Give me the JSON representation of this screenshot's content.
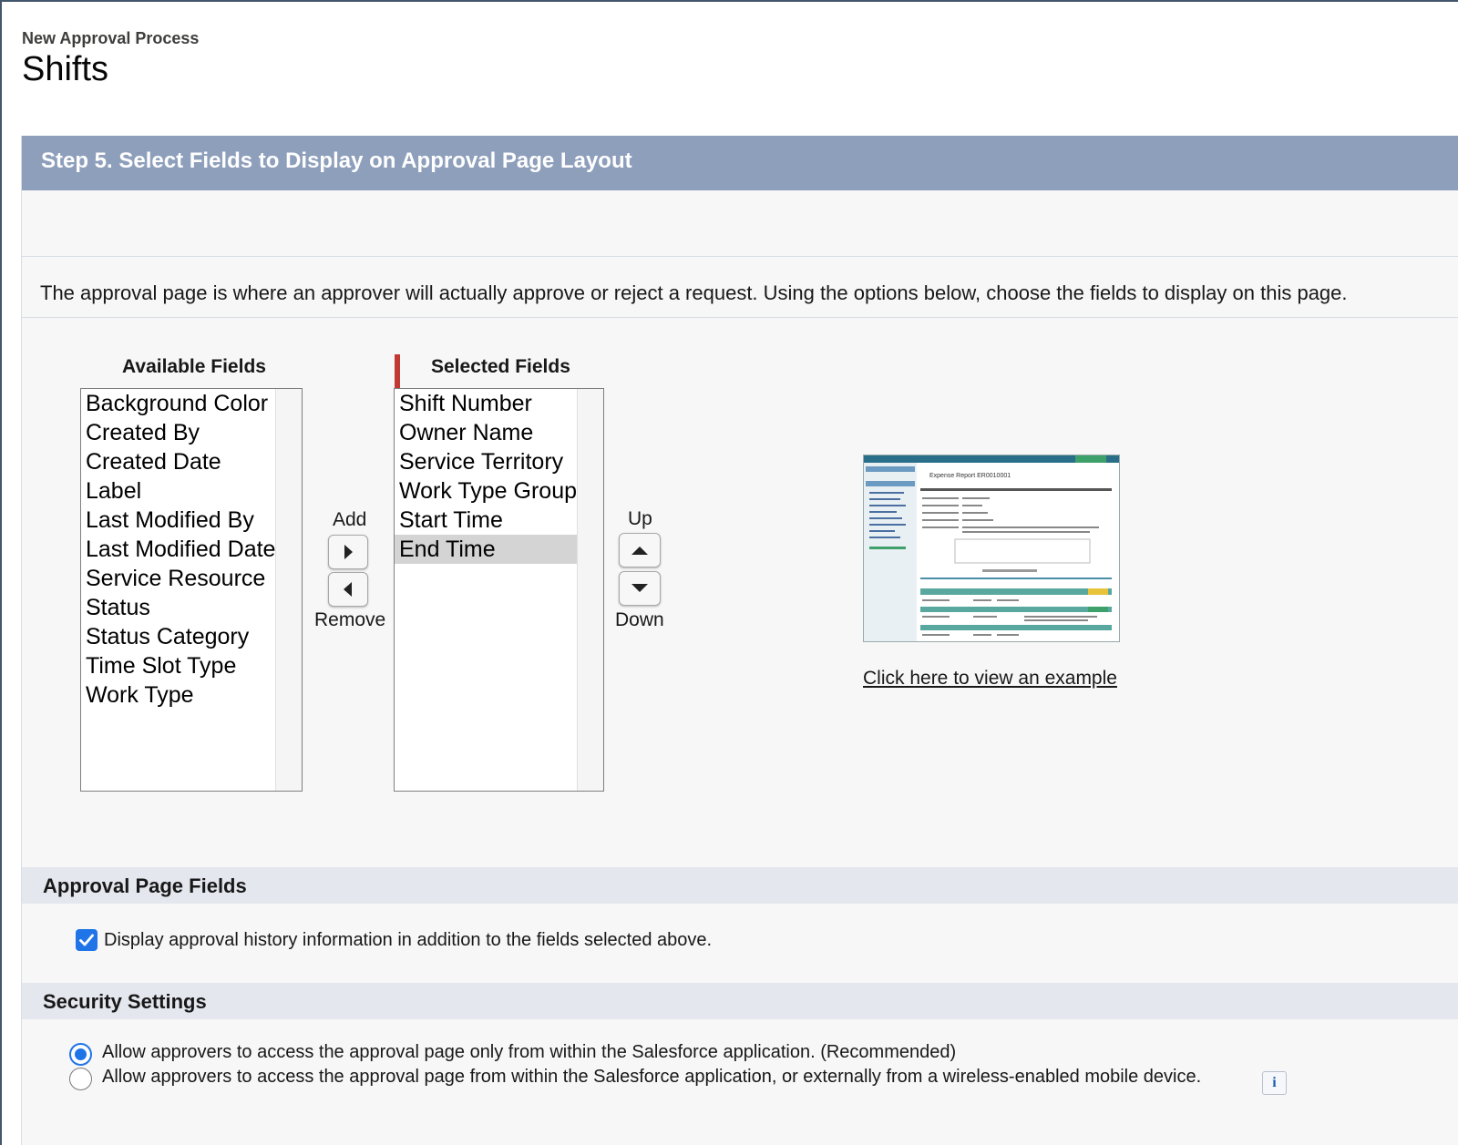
{
  "header": {
    "subtitle": "New Approval Process",
    "title": "Shifts"
  },
  "step": {
    "title": "Step 5. Select Fields to Display on Approval Page Layout"
  },
  "intro_text": "The approval page is where an approver will actually approve or reject a request. Using the options below, choose the fields to display on this page.",
  "available_fields": {
    "label": "Available Fields",
    "options": [
      "Background Color",
      "Created By",
      "Created Date",
      "Label",
      "Last Modified By",
      "Last Modified Date",
      "Service Resource",
      "Status",
      "Status Category",
      "Time Slot Type",
      "Work Type"
    ]
  },
  "selected_fields": {
    "label": "Selected Fields",
    "options": [
      "Shift Number",
      "Owner Name",
      "Service Territory",
      "Work Type Group",
      "Start Time",
      "End Time"
    ],
    "selected": "End Time"
  },
  "buttons": {
    "add_label": "Add",
    "remove_label": "Remove",
    "up_label": "Up",
    "down_label": "Down"
  },
  "example": {
    "link_text": "Click here to view an example",
    "thumb_title": "Expense Report ER0010001"
  },
  "approval_page_fields": {
    "heading": "Approval Page Fields",
    "checkbox_label": "Display approval history information in addition to the fields selected above.",
    "checked": true
  },
  "security_settings": {
    "heading": "Security Settings",
    "options": [
      "Allow approvers to access the approval page only from within the Salesforce application. (Recommended)",
      "Allow approvers to access the approval page from within the Salesforce application, or externally from a wireless-enabled mobile device."
    ],
    "selected_index": 0
  },
  "info_icon_glyph": "i",
  "colors": {
    "step_bar": "#8e9fbc",
    "section_bar": "#e4e7ee",
    "accent_blue": "#1f75e8",
    "marker_red": "#c23934"
  }
}
